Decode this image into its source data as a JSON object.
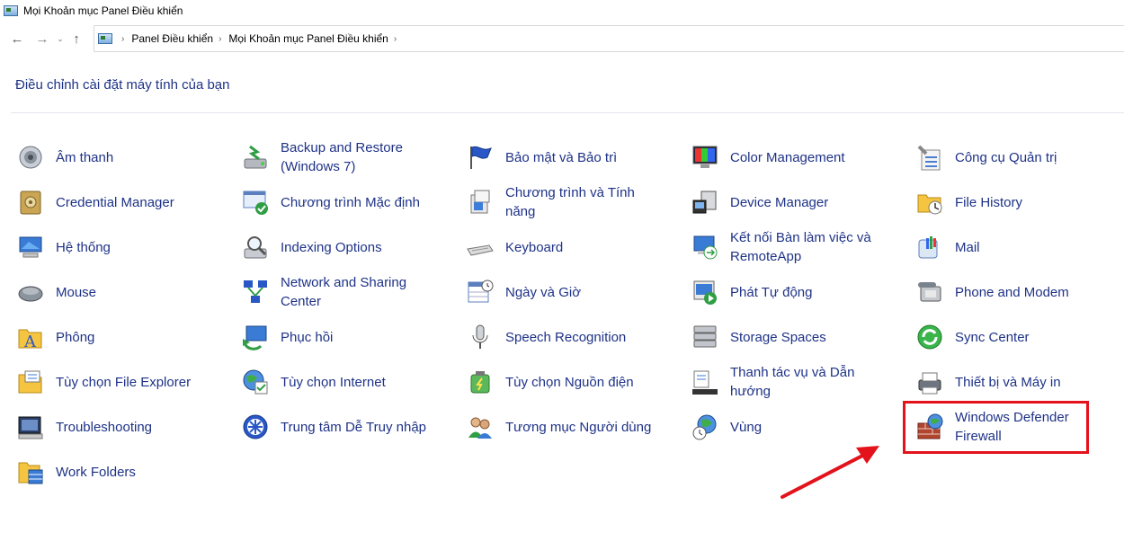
{
  "window": {
    "title": "Mọi Khoản mục Panel Điều khiển"
  },
  "nav": {
    "back_icon": "arrow-left-icon",
    "forward_icon": "arrow-right-icon",
    "recent_icon": "chevron-down-icon",
    "up_icon": "arrow-up-icon"
  },
  "address": {
    "crumbs": [
      "Panel Điều khiển",
      "Mọi Khoản mục Panel Điều khiển"
    ]
  },
  "header": {
    "title": "Điều chỉnh cài đặt máy tính của bạn"
  },
  "items": [
    {
      "label": "Âm thanh",
      "icon": "speaker-icon"
    },
    {
      "label": "Backup and Restore (Windows 7)",
      "icon": "backup-icon"
    },
    {
      "label": "Bảo mật và Bảo trì",
      "icon": "flag-icon"
    },
    {
      "label": "Color Management",
      "icon": "color-monitor-icon"
    },
    {
      "label": "Công cụ Quản trị",
      "icon": "admin-tools-icon"
    },
    {
      "label": "Credential Manager",
      "icon": "vault-icon"
    },
    {
      "label": "Chương trình Mặc định",
      "icon": "default-programs-icon"
    },
    {
      "label": "Chương trình và Tính năng",
      "icon": "programs-icon"
    },
    {
      "label": "Device Manager",
      "icon": "device-manager-icon"
    },
    {
      "label": "File History",
      "icon": "file-history-icon"
    },
    {
      "label": "Hệ thống",
      "icon": "computer-icon"
    },
    {
      "label": "Indexing Options",
      "icon": "indexing-icon"
    },
    {
      "label": "Keyboard",
      "icon": "keyboard-icon"
    },
    {
      "label": "Kết nối Bàn làm việc và RemoteApp",
      "icon": "remoteapp-icon"
    },
    {
      "label": "Mail",
      "icon": "mail-icon"
    },
    {
      "label": "Mouse",
      "icon": "mouse-icon"
    },
    {
      "label": "Network and Sharing Center",
      "icon": "network-icon"
    },
    {
      "label": "Ngày và Giờ",
      "icon": "calendar-clock-icon"
    },
    {
      "label": "Phát Tự động",
      "icon": "autoplay-icon"
    },
    {
      "label": "Phone and Modem",
      "icon": "phone-icon"
    },
    {
      "label": "Phông",
      "icon": "font-folder-icon"
    },
    {
      "label": "Phục hồi",
      "icon": "recovery-icon"
    },
    {
      "label": "Speech Recognition",
      "icon": "microphone-icon"
    },
    {
      "label": "Storage Spaces",
      "icon": "storage-icon"
    },
    {
      "label": "Sync Center",
      "icon": "sync-icon"
    },
    {
      "label": "Tùy chọn File Explorer",
      "icon": "folder-options-icon"
    },
    {
      "label": "Tùy chọn Internet",
      "icon": "internet-options-icon"
    },
    {
      "label": "Tùy chọn Nguồn điện",
      "icon": "power-icon"
    },
    {
      "label": "Thanh tác vụ và Dẫn hướng",
      "icon": "taskbar-icon"
    },
    {
      "label": "Thiết bị và Máy in",
      "icon": "printer-icon"
    },
    {
      "label": "Troubleshooting",
      "icon": "troubleshoot-icon"
    },
    {
      "label": "Trung tâm Dễ Truy nhập",
      "icon": "ease-of-access-icon"
    },
    {
      "label": "Tương mục Người dùng",
      "icon": "users-icon"
    },
    {
      "label": "Vùng",
      "icon": "region-icon"
    },
    {
      "label": "Windows Defender Firewall",
      "icon": "firewall-icon"
    },
    {
      "label": "Work Folders",
      "icon": "work-folders-icon"
    }
  ],
  "colors": {
    "link": "#1e3287",
    "highlight": "#e3121b"
  }
}
